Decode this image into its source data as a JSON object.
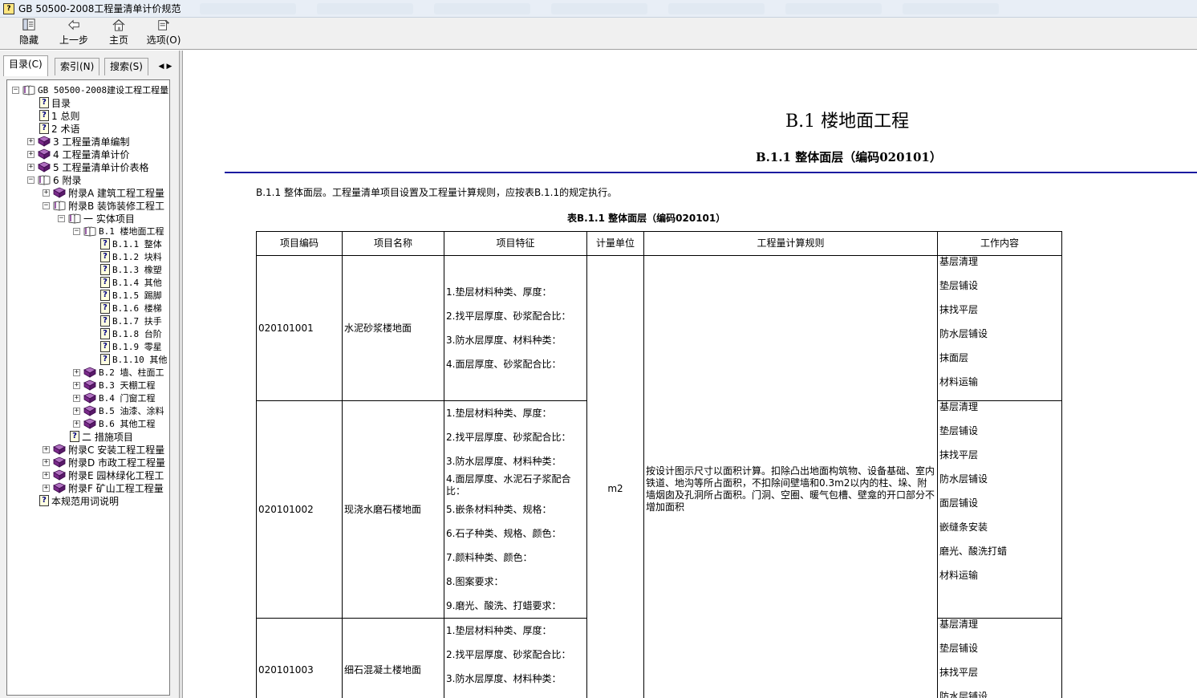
{
  "window": {
    "title": "GB 50500-2008工程量清单计价规范"
  },
  "toolbar": {
    "hide_label": "隐藏",
    "back_label": "上一步",
    "home_label": "主页",
    "options_label": "选项(O)"
  },
  "nav_tabs": {
    "contents": "目录(C)",
    "index": "索引(N)",
    "search": "搜索(S)"
  },
  "tree": [
    {
      "label": "GB 50500-2008建设工程工程量",
      "level": 0,
      "icon": "book-open",
      "exp": "−",
      "mono": true
    },
    {
      "label": "目录",
      "level": 1,
      "icon": "help-page",
      "exp": ""
    },
    {
      "label": "1 总则",
      "level": 1,
      "icon": "help-page",
      "exp": ""
    },
    {
      "label": "2 术语",
      "level": 1,
      "icon": "help-page",
      "exp": ""
    },
    {
      "label": "3 工程量清单编制",
      "level": 1,
      "icon": "book-closed",
      "exp": "+"
    },
    {
      "label": "4 工程量清单计价",
      "level": 1,
      "icon": "book-closed",
      "exp": "+"
    },
    {
      "label": "5 工程量清单计价表格",
      "level": 1,
      "icon": "book-closed",
      "exp": "+"
    },
    {
      "label": "6 附录",
      "level": 1,
      "icon": "book-open",
      "exp": "−"
    },
    {
      "label": "附录A 建筑工程工程量",
      "level": 2,
      "icon": "book-closed",
      "exp": "+"
    },
    {
      "label": "附录B 装饰装修工程工",
      "level": 2,
      "icon": "book-open",
      "exp": "−"
    },
    {
      "label": "一   实体项目",
      "level": 3,
      "icon": "book-open",
      "exp": "−"
    },
    {
      "label": "B.1 楼地面工程",
      "level": 4,
      "icon": "book-open",
      "exp": "−",
      "mono": true
    },
    {
      "label": "B.1.1 整体",
      "level": 5,
      "icon": "help-page",
      "exp": "",
      "mono": true
    },
    {
      "label": "B.1.2 块料",
      "level": 5,
      "icon": "help-page",
      "exp": "",
      "mono": true
    },
    {
      "label": "B.1.3 橡塑",
      "level": 5,
      "icon": "help-page",
      "exp": "",
      "mono": true
    },
    {
      "label": "B.1.4 其他",
      "level": 5,
      "icon": "help-page",
      "exp": "",
      "mono": true
    },
    {
      "label": "B.1.5 踢脚",
      "level": 5,
      "icon": "help-page",
      "exp": "",
      "mono": true
    },
    {
      "label": "B.1.6 楼梯",
      "level": 5,
      "icon": "help-page",
      "exp": "",
      "mono": true
    },
    {
      "label": "B.1.7 扶手",
      "level": 5,
      "icon": "help-page",
      "exp": "",
      "mono": true
    },
    {
      "label": "B.1.8 台阶",
      "level": 5,
      "icon": "help-page",
      "exp": "",
      "mono": true
    },
    {
      "label": "B.1.9 零星",
      "level": 5,
      "icon": "help-page",
      "exp": "",
      "mono": true
    },
    {
      "label": "B.1.10 其他",
      "level": 5,
      "icon": "help-page",
      "exp": "",
      "mono": true
    },
    {
      "label": "B.2 墙、柱面工",
      "level": 4,
      "icon": "book-closed",
      "exp": "+",
      "mono": true
    },
    {
      "label": "B.3 天棚工程",
      "level": 4,
      "icon": "book-closed",
      "exp": "+",
      "mono": true
    },
    {
      "label": "B.4 门窗工程",
      "level": 4,
      "icon": "book-closed",
      "exp": "+",
      "mono": true
    },
    {
      "label": "B.5 油漆、涂料",
      "level": 4,
      "icon": "book-closed",
      "exp": "+",
      "mono": true
    },
    {
      "label": "B.6 其他工程",
      "level": 4,
      "icon": "book-closed",
      "exp": "+",
      "mono": true
    },
    {
      "label": "二  措施项目",
      "level": 3,
      "icon": "help-page",
      "exp": ""
    },
    {
      "label": "附录C 安装工程工程量",
      "level": 2,
      "icon": "book-closed",
      "exp": "+"
    },
    {
      "label": "附录D 市政工程工程量",
      "level": 2,
      "icon": "book-closed",
      "exp": "+"
    },
    {
      "label": "附录E 园林绿化工程工",
      "level": 2,
      "icon": "book-closed",
      "exp": "+"
    },
    {
      "label": "附录F 矿山工程工程量",
      "level": 2,
      "icon": "book-closed",
      "exp": "+"
    },
    {
      "label": "本规范用词说明",
      "level": 1,
      "icon": "help-page",
      "exp": ""
    }
  ],
  "document": {
    "title": "B.1 楼地面工程",
    "subtitle": "B.1.1 整体面层（编码020101）",
    "intro": "B.1.1  整体面层。工程量清单项目设置及工程量计算规则，应按表B.1.1的规定执行。",
    "table_caption": "表B.1.1  整体面层（编码020101）",
    "headers": [
      "项目编码",
      "项目名称",
      "项目特征",
      "计量单位",
      "工程量计算规则",
      "工作内容"
    ],
    "unit": "m2",
    "rule": "按设计图示尺寸以面积计算。扣除凸出地面构筑物、设备基础、室内铁道、地沟等所占面积，不扣除间壁墙和0.3m2以内的柱、垛、附墙烟囱及孔洞所占面积。门洞、空圈、暖气包槽、壁龛的开口部分不增加面积",
    "rows": [
      {
        "code": "020101001",
        "name": "水泥砂浆楼地面",
        "features": [
          "1.垫层材料种类、厚度：",
          "2.找平层厚度、砂浆配合比：",
          "3.防水层厚度、材料种类：",
          "4.面层厚度、砂浆配合比："
        ],
        "work": [
          "基层清理",
          "垫层铺设",
          "抹找平层",
          "防水层铺设",
          "抹面层",
          "材料运输"
        ]
      },
      {
        "code": "020101002",
        "name": "现浇水磨石楼地面",
        "features": [
          "1.垫层材料种类、厚度：",
          "2.找平层厚度、砂浆配合比：",
          "3.防水层厚度、材料种类：",
          "4.面层厚度、水泥石子浆配合比：",
          "5.嵌条材料种类、规格：",
          "6.石子种类、规格、颜色：",
          "7.颜料种类、颜色：",
          "8.图案要求：",
          "9.磨光、酸洗、打蜡要求："
        ],
        "work": [
          "基层清理",
          "垫层铺设",
          "抹找平层",
          "防水层铺设",
          "面层铺设",
          "嵌缝条安装",
          "磨光、酸洗打蜡",
          "材料运输"
        ]
      },
      {
        "code": "020101003",
        "name": "细石混凝土楼地面",
        "features": [
          "1.垫层材料种类、厚度：",
          "2.找平层厚度、砂浆配合比：",
          "3.防水层厚度、材料种类："
        ],
        "work": [
          "基层清理",
          "垫层铺设",
          "抹找平层",
          "防水层铺设"
        ]
      }
    ]
  },
  "colors": {
    "rule_blue": "#1a1aa0",
    "book_purple": "#7a2a8a",
    "toolbar_bg": "#f0f0f0"
  }
}
